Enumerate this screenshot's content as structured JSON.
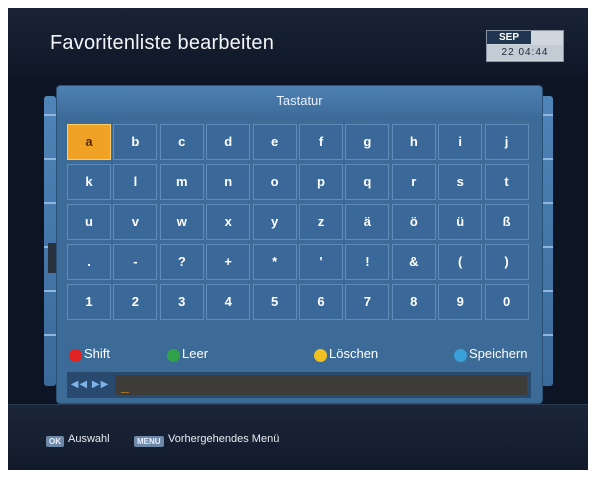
{
  "header": {
    "title": "Favoritenliste bearbeiten",
    "date_month": "SEP",
    "date_day": "22",
    "time": "04:44"
  },
  "keyboard": {
    "title": "Tastatur",
    "selected_key": "a",
    "rows": [
      [
        "a",
        "b",
        "c",
        "d",
        "e",
        "f",
        "g",
        "h",
        "i",
        "j"
      ],
      [
        "k",
        "l",
        "m",
        "n",
        "o",
        "p",
        "q",
        "r",
        "s",
        "t"
      ],
      [
        "u",
        "v",
        "w",
        "x",
        "y",
        "z",
        "ä",
        "ö",
        "ü",
        "ß"
      ],
      [
        ".",
        "-",
        "?",
        "+",
        "*",
        "'",
        "!",
        "&",
        "(",
        ")"
      ],
      [
        "1",
        "2",
        "3",
        "4",
        "5",
        "6",
        "7",
        "8",
        "9",
        "0"
      ]
    ]
  },
  "legend": [
    {
      "label": "Shift",
      "color": "#e02424",
      "icon": "red-button-icon"
    },
    {
      "label": "Leer",
      "color": "#2fa24a",
      "icon": "green-button-icon"
    },
    {
      "label": "Löschen",
      "color": "#f0c020",
      "icon": "yellow-button-icon"
    },
    {
      "label": "Speichern",
      "color": "#3aa0d8",
      "icon": "blue-button-icon"
    }
  ],
  "input": {
    "nav_icon": "skip-arrows-icon",
    "value": ""
  },
  "footer": {
    "ok_tag": "OK",
    "ok_label": "Auswahl",
    "menu_tag": "MENU",
    "menu_label": "Vorhergehendes Menü"
  },
  "colors": {
    "panel": "#3d6b98",
    "key_selected": "#f0a224",
    "background": "#0d1524"
  }
}
